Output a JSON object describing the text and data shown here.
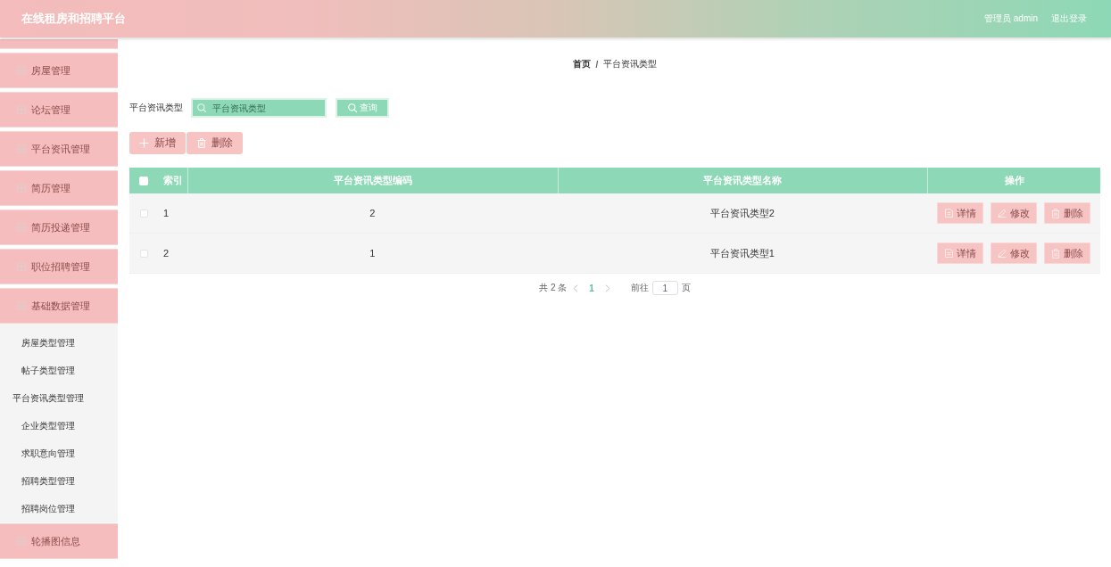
{
  "header": {
    "title": "在线租房和招聘平台",
    "user": "管理员 admin",
    "logout": "退出登录"
  },
  "sidebar": {
    "items": [
      {
        "label": "房屋管理"
      },
      {
        "label": "论坛管理"
      },
      {
        "label": "平台资讯管理"
      },
      {
        "label": "简历管理"
      },
      {
        "label": "简历投递管理"
      },
      {
        "label": "职位招聘管理"
      },
      {
        "label": "基础数据管理",
        "children": [
          {
            "label": "房屋类型管理"
          },
          {
            "label": "帖子类型管理"
          },
          {
            "label": "平台资讯类型管理"
          },
          {
            "label": "企业类型管理"
          },
          {
            "label": "求职意向管理"
          },
          {
            "label": "招聘类型管理"
          },
          {
            "label": "招聘岗位管理"
          }
        ]
      },
      {
        "label": "轮播图信息"
      }
    ]
  },
  "breadcrumb": {
    "items": [
      "首页",
      "平台资讯类型"
    ],
    "separator": "/"
  },
  "search": {
    "label": "平台资讯类型",
    "placeholder": "平台资讯类型",
    "button": "查询"
  },
  "actions": [
    {
      "label": "新增",
      "kind": "add"
    },
    {
      "label": "删除",
      "kind": "delete"
    }
  ],
  "table": {
    "select_all_checked": false,
    "columns": [
      "索引",
      "平台资讯类型编码",
      "平台资讯类型名称",
      "操作"
    ],
    "rows": [
      {
        "checked": false,
        "cells": [
          "1",
          "2",
          "平台资讯类型2"
        ],
        "actions": [
          {
            "label": "详情",
            "kind": "detail"
          },
          {
            "label": "修改",
            "kind": "edit"
          },
          {
            "label": "删除",
            "kind": "delete"
          }
        ]
      },
      {
        "checked": false,
        "cells": [
          "2",
          "1",
          "平台资讯类型1"
        ],
        "actions": [
          {
            "label": "详情",
            "kind": "detail"
          },
          {
            "label": "修改",
            "kind": "edit"
          },
          {
            "label": "删除",
            "kind": "delete"
          }
        ]
      }
    ]
  },
  "pagination": {
    "total": "共 2 条",
    "pages": [
      {
        "label": "1",
        "selected": true
      }
    ],
    "goto_label": "前往",
    "goto_value": "1",
    "page_suffix": "页"
  }
}
